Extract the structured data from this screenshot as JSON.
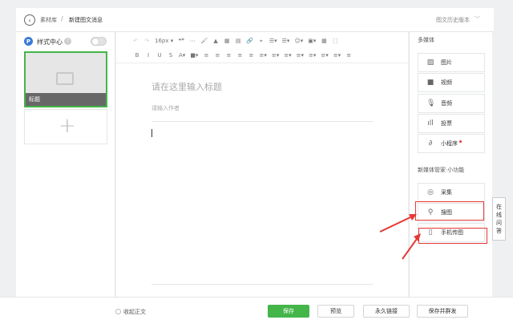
{
  "header": {
    "back_icon": "chevron-left-icon",
    "crumb_library": "素材库",
    "crumb_sep": "/",
    "crumb_current": "新建图文消息",
    "history_label": "图文历史版本",
    "history_chevron": "﹀"
  },
  "left": {
    "style_logo": "P",
    "style_title": "样式中心",
    "help": "?",
    "card_title": "标题",
    "add_symbol": "+"
  },
  "toolbar": {
    "row1": [
      "↶",
      "↷",
      "16px ▾",
      "❝❞",
      "⋯",
      "🖌",
      "▲",
      "▦",
      "▤",
      "🔗",
      "⌖",
      "☰▾",
      "☰▾",
      "☺▾",
      "▣▾",
      "▦",
      "⬚"
    ],
    "row2": [
      "B",
      "I",
      "U",
      "S",
      "A▾",
      "■▾",
      "≡",
      "≡",
      "≡",
      "≡",
      "≡",
      "≡▾",
      "≡▾",
      "≡▾",
      "≡▾",
      "≡▾",
      "≡▾",
      "≡▾",
      "≡"
    ]
  },
  "editor": {
    "title_placeholder": "请在这里输入标题",
    "author_placeholder": "请输入作者"
  },
  "right": {
    "media_title": "多媒体",
    "media_items": [
      {
        "icon": "image-icon",
        "glyph": "▨",
        "label": "图片"
      },
      {
        "icon": "video-icon",
        "glyph": "■",
        "label": "视频"
      },
      {
        "icon": "audio-icon",
        "glyph": "🎙",
        "label": "音频"
      },
      {
        "icon": "poll-icon",
        "glyph": "ıll",
        "label": "投票"
      },
      {
        "icon": "miniprogram-icon",
        "glyph": "∂",
        "label": "小程序"
      }
    ],
    "tools_title": "新媒体管家·小功能",
    "tool_items": [
      {
        "icon": "collect-icon",
        "glyph": "◎",
        "label": "采集"
      },
      {
        "icon": "search-image-icon",
        "glyph": "⚲",
        "label": "搜图"
      },
      {
        "icon": "phone-upload-icon",
        "glyph": "▯",
        "label": "手机传图"
      }
    ]
  },
  "float_tab": {
    "chars": [
      "在",
      "线",
      "问",
      "答"
    ]
  },
  "footer": {
    "collapse_label": "收起正文",
    "save": "保存",
    "preview": "预览",
    "permalink": "永久链接",
    "save_send": "保存并群发"
  },
  "colors": {
    "accent": "#44b549",
    "annotation": "#e53935",
    "logo": "#3a7bd5"
  }
}
